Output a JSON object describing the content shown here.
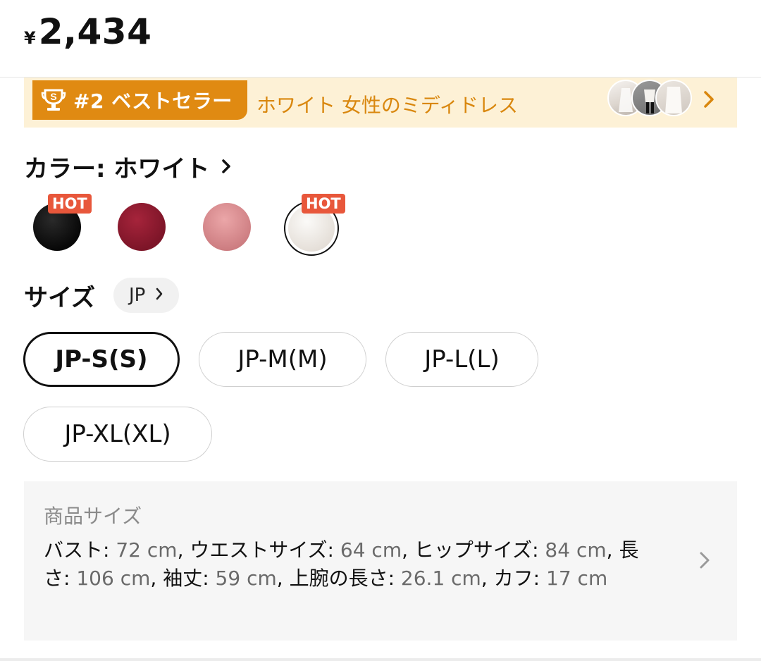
{
  "price": {
    "currency": "¥",
    "amount": "2,434"
  },
  "banner": {
    "rank": "#2 ベストセラー",
    "category": "ホワイト 女性のミディドレス",
    "icon": "trophy-icon",
    "colors": {
      "background": "#fdf1d6",
      "badge": "#e08a12",
      "text": "#d9870e"
    }
  },
  "color_selector": {
    "label": "カラー: ホワイト",
    "hot_badge": "HOT",
    "swatches": [
      {
        "name": "black",
        "color": "#0b0b0b",
        "hot": true,
        "selected": false
      },
      {
        "name": "burgundy",
        "color": "#8a1a2e",
        "hot": false,
        "selected": false
      },
      {
        "name": "pink",
        "color": "#d98c90",
        "hot": false,
        "selected": false
      },
      {
        "name": "white",
        "color": "#ece8e2",
        "hot": true,
        "selected": true
      }
    ]
  },
  "size_selector": {
    "label": "サイズ",
    "region": "JP",
    "options": [
      {
        "label": "JP-S(S)",
        "selected": true
      },
      {
        "label": "JP-M(M)",
        "selected": false
      },
      {
        "label": "JP-L(L)",
        "selected": false
      },
      {
        "label": "JP-XL(XL)",
        "selected": false
      }
    ]
  },
  "product_size": {
    "title": "商品サイズ",
    "specs": [
      {
        "k": "バスト",
        "v": "72 cm"
      },
      {
        "k": "ウエストサイズ",
        "v": "64 cm"
      },
      {
        "k": "ヒップサイズ",
        "v": "84 cm"
      },
      {
        "k": "長さ",
        "v": "106 cm"
      },
      {
        "k": "袖丈",
        "v": "59 cm"
      },
      {
        "k": "上腕の長さ",
        "v": "26.1 cm"
      },
      {
        "k": "カフ",
        "v": "17 cm"
      }
    ]
  }
}
